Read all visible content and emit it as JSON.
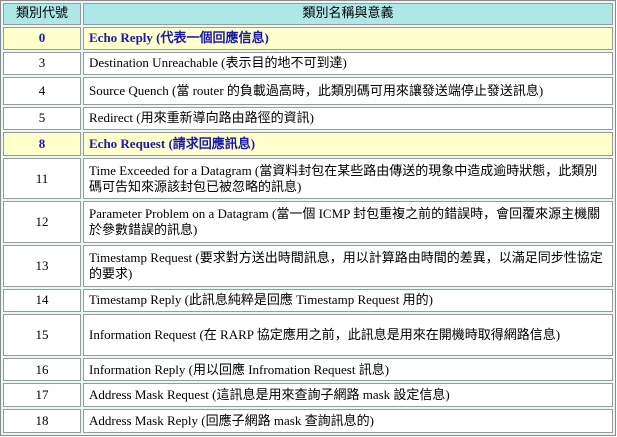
{
  "table": {
    "headers": [
      "類別代號",
      "類別名稱與意義"
    ],
    "rows": [
      {
        "code": "0",
        "desc": "Echo Reply (代表一個回應信息)",
        "highlight": true
      },
      {
        "code": "3",
        "desc": "Destination Unreachable (表示目的地不可到達)",
        "highlight": false
      },
      {
        "code": "4",
        "desc": "Source Quench (當 router 的負載過高時，此類別碼可用來讓發送端停止發送訊息)",
        "highlight": false
      },
      {
        "code": "5",
        "desc": "Redirect (用來重新導向路由路徑的資訊)",
        "highlight": false
      },
      {
        "code": "8",
        "desc": "Echo Request (請求回應訊息)",
        "highlight": true
      },
      {
        "code": "11",
        "desc": "Time Exceeded for a Datagram (當資料封包在某些路由傳送的現象中造成逾時狀態，此類別碼可告知來源該封包已被忽略的訊息)",
        "highlight": false
      },
      {
        "code": "12",
        "desc": "Parameter Problem on a Datagram (當一個 ICMP 封包重複之前的錯誤時，會回覆來源主機關於參數錯誤的訊息)",
        "highlight": false
      },
      {
        "code": "13",
        "desc": "Timestamp Request (要求對方送出時間訊息，用以計算路由時間的差異，以滿足同步性協定的要求)",
        "highlight": false
      },
      {
        "code": "14",
        "desc": "Timestamp Reply (此訊息純粹是回應 Timestamp Request 用的)",
        "highlight": false
      },
      {
        "code": "15",
        "desc": "Information Request (在 RARP 協定應用之前，此訊息是用來在開機時取得網路信息)",
        "highlight": false
      },
      {
        "code": "16",
        "desc": "Information Reply (用以回應 Infromation Request 訊息)",
        "highlight": false
      },
      {
        "code": "17",
        "desc": "Address Mask Request (這訊息是用來查詢子網路 mask 設定信息)",
        "highlight": false
      },
      {
        "code": "18",
        "desc": "Address Mask Reply (回應子網路 mask 查詢訊息的)",
        "highlight": false
      }
    ]
  },
  "colors": {
    "header_bg": "#afe6e6",
    "highlight_bg": "#ffffcc",
    "highlight_text": "#1a1aa8"
  }
}
